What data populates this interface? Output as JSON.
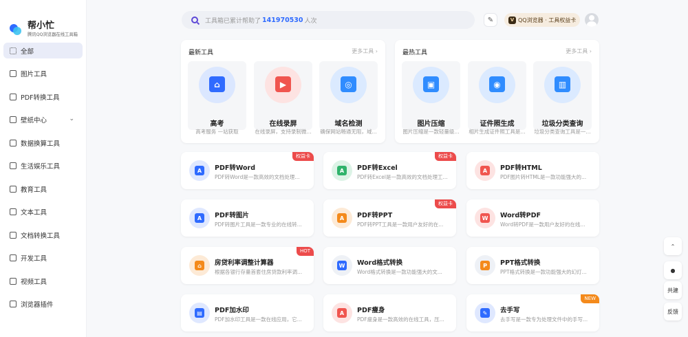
{
  "brand": {
    "name": "帮小忙",
    "subtitle": "腾讯QQ浏览器在线工具箱"
  },
  "sidebar": {
    "items": [
      {
        "label": "全部",
        "icon": "grid-icon",
        "active": true
      },
      {
        "label": "图片工具",
        "icon": "image-icon"
      },
      {
        "label": "PDF转换工具",
        "icon": "pdf-icon"
      },
      {
        "label": "壁纸中心",
        "icon": "wallpaper-icon",
        "expandable": true
      },
      {
        "label": "数据换算工具",
        "icon": "calc-icon"
      },
      {
        "label": "生活娱乐工具",
        "icon": "life-icon"
      },
      {
        "label": "教育工具",
        "icon": "edu-icon"
      },
      {
        "label": "文本工具",
        "icon": "text-icon"
      },
      {
        "label": "文档转换工具",
        "icon": "doc-icon"
      },
      {
        "label": "开发工具",
        "icon": "dev-icon"
      },
      {
        "label": "视频工具",
        "icon": "video-icon"
      },
      {
        "label": "浏览器插件",
        "icon": "plugin-icon"
      }
    ]
  },
  "search": {
    "prefix": "工具箱已累计帮助了",
    "count": "141970530",
    "suffix": "人次"
  },
  "header": {
    "vip_label": "QQ浏览器 · 工具权益卡",
    "vip_badge": "V"
  },
  "latest": {
    "title": "最新工具",
    "more": "更多工具 ›",
    "tiles": [
      {
        "name": "高考",
        "desc": "高考服务 一站获取",
        "color": "#2f6bff",
        "bg": "#dbe7ff",
        "glyph": "⌂"
      },
      {
        "name": "在线录屏",
        "desc": "在线录屏，支持录制微...",
        "color": "#f0554f",
        "bg": "#fde3e2",
        "glyph": "▶"
      },
      {
        "name": "域名检测",
        "desc": "确保网站畅通无阻，域...",
        "color": "#2f8cff",
        "bg": "#dbeaff",
        "glyph": "◎"
      }
    ]
  },
  "hot": {
    "title": "最热工具",
    "more": "更多工具 ›",
    "tiles": [
      {
        "name": "图片压缩",
        "desc": "图片压缩是一款轻量级...",
        "color": "#2f8cff",
        "bg": "#dbeaff",
        "glyph": "▣"
      },
      {
        "name": "证件照生成",
        "desc": "相片生成证件照工具是...",
        "color": "#2f8cff",
        "bg": "#dbeaff",
        "glyph": "◉"
      },
      {
        "name": "垃圾分类查询",
        "desc": "垃圾分类查询工具是一...",
        "color": "#2f8cff",
        "bg": "#dbeaff",
        "glyph": "▥"
      }
    ]
  },
  "tools": [
    {
      "title": "PDF转Word",
      "desc": "PDF转Word是一款高效的文档处理...",
      "color": "#2f6bff",
      "bg": "#dfe8ff",
      "glyph": "A",
      "badge": "权益卡",
      "badge_type": "red"
    },
    {
      "title": "PDF转Excel",
      "desc": "PDF转Excel是一款高效的文档处理工...",
      "color": "#2fb36b",
      "bg": "#dcf3e6",
      "glyph": "A",
      "badge": "权益卡",
      "badge_type": "red"
    },
    {
      "title": "PDF转HTML",
      "desc": "PDF图片转HTML是一款功能强大的...",
      "color": "#f0554f",
      "bg": "#fde3e2",
      "glyph": "A",
      "badge": "",
      "badge_type": ""
    },
    {
      "title": "PDF转图片",
      "desc": "PDF转图片工具是一款专业的在线转...",
      "color": "#2f6bff",
      "bg": "#dfe8ff",
      "glyph": "A",
      "badge": "",
      "badge_type": ""
    },
    {
      "title": "PDF转PPT",
      "desc": "PDF转PPT工具是一款用户友好的在...",
      "color": "#f48a1b",
      "bg": "#fdead6",
      "glyph": "A",
      "badge": "权益卡",
      "badge_type": "red"
    },
    {
      "title": "Word转PDF",
      "desc": "Word转PDF是一款用户友好的在线...",
      "color": "#f0554f",
      "bg": "#fde3e2",
      "glyph": "W",
      "badge": "",
      "badge_type": ""
    },
    {
      "title": "房贷利率调整计算器",
      "desc": "根据各银行存量首套住房贷款利率调...",
      "color": "#f48a1b",
      "bg": "#fdead6",
      "glyph": "⌂",
      "badge": "HOT",
      "badge_type": "red"
    },
    {
      "title": "Word格式转换",
      "desc": "Word格式转换是一款功能强大的文...",
      "color": "#2f6bff",
      "bg": "#eef1f6",
      "glyph": "W",
      "badge": "",
      "badge_type": ""
    },
    {
      "title": "PPT格式转换",
      "desc": "PPT格式转换是一款功能强大的幻灯...",
      "color": "#f48a1b",
      "bg": "#eef1f6",
      "glyph": "P",
      "badge": "",
      "badge_type": ""
    },
    {
      "title": "PDF加水印",
      "desc": "PDF加水印工具是一款在线应用，它...",
      "color": "#2f6bff",
      "bg": "#dfe8ff",
      "glyph": "▤",
      "badge": "",
      "badge_type": ""
    },
    {
      "title": "PDF瘦身",
      "desc": "PDF瘦身是一款高效的在线工具，压...",
      "color": "#f0554f",
      "bg": "#fde3e2",
      "glyph": "A",
      "badge": "",
      "badge_type": ""
    },
    {
      "title": "去手写",
      "desc": "去手写是一款专为处理文件中的手写...",
      "color": "#2f6bff",
      "bg": "#dfe8ff",
      "glyph": "✎",
      "badge": "NEW",
      "badge_type": "orange"
    }
  ],
  "floats": [
    {
      "name": "back-to-top-button",
      "label": "⌃"
    },
    {
      "name": "qq-button",
      "label": "●"
    },
    {
      "name": "co-build-button",
      "label": "共建"
    },
    {
      "name": "feedback-button",
      "label": "反馈"
    }
  ]
}
